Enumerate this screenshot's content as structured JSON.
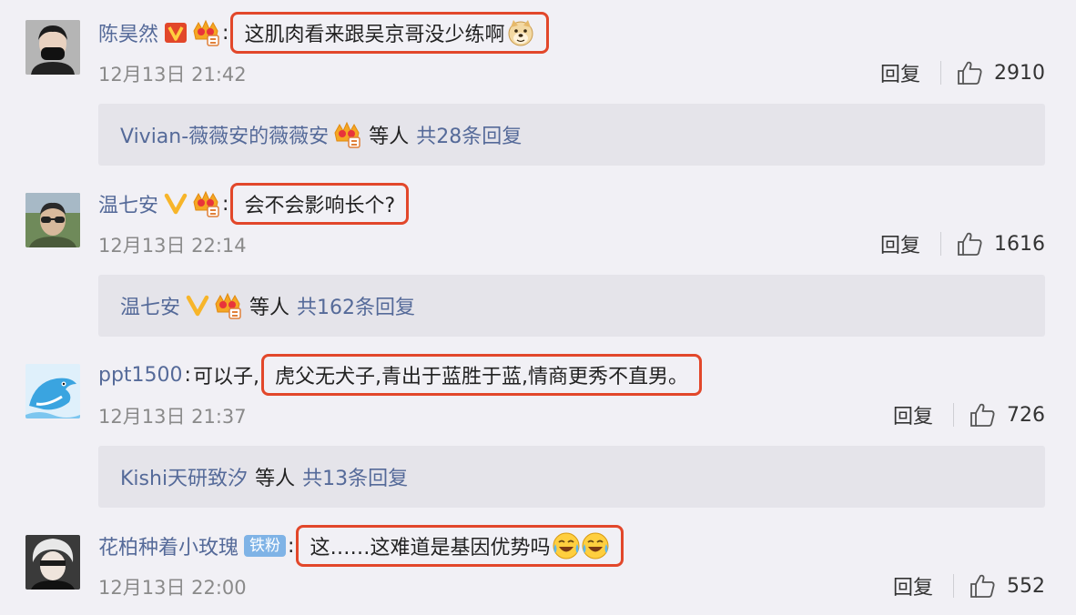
{
  "comments": [
    {
      "username": "陈昊然",
      "badge": "v-red",
      "text": "这肌肉看来跟吴京哥没少练啊",
      "emoji": "doge-emoji",
      "time": "12月13日 21:42",
      "reply_label": "回复",
      "likes": "2910",
      "reply_summary": {
        "name": "Vivian-薇薇安的薇薇安",
        "etc": "等人",
        "total": "共28条回复"
      }
    },
    {
      "username": "温七安",
      "badge": "v-gold",
      "text": "会不会影响长个?",
      "time": "12月13日 22:14",
      "reply_label": "回复",
      "likes": "1616",
      "reply_summary": {
        "name": "温七安",
        "etc": "等人",
        "total": "共162条回复"
      }
    },
    {
      "username": "ppt1500",
      "prefix": "可以子,",
      "text": "虎父无犬子,青出于蓝胜于蓝,情商更秀不直男。",
      "time": "12月13日 21:37",
      "reply_label": "回复",
      "likes": "726",
      "reply_summary": {
        "name": "Kishi天研致汐",
        "etc": "等人",
        "total": "共13条回复"
      }
    },
    {
      "username": "花柏种着小玫瑰",
      "fan_badge": "铁粉",
      "text": "这……这难道是基因优势吗",
      "emoji": "laugh-cry-emoji",
      "time": "12月13日 22:00",
      "reply_label": "回复",
      "likes": "552"
    }
  ],
  "colors": {
    "link": "#556a99",
    "highlight": "#e2472a",
    "bg": "#f1f0f5"
  }
}
